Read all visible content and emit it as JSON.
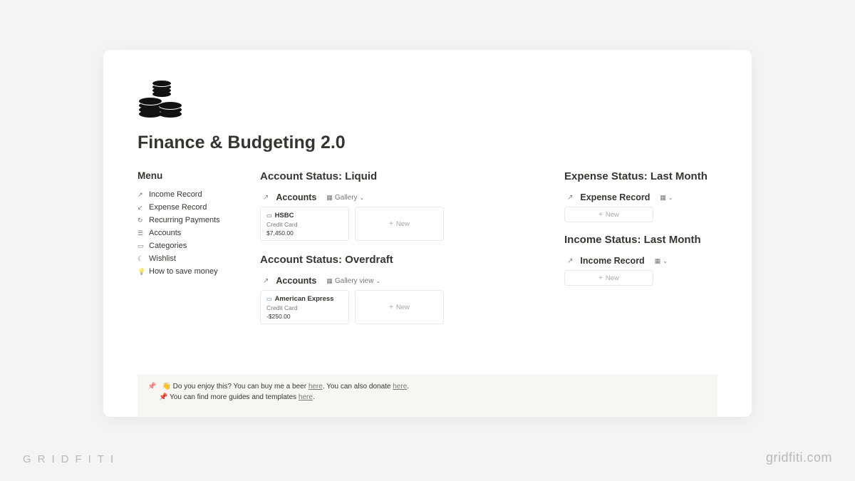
{
  "page": {
    "title": "Finance & Budgeting 2.0"
  },
  "menu": {
    "heading": "Menu",
    "items": [
      {
        "icon": "↗",
        "label": "Income Record"
      },
      {
        "icon": "↙",
        "label": "Expense Record"
      },
      {
        "icon": "↻",
        "label": "Recurring Payments"
      },
      {
        "icon": "☰",
        "label": "Accounts"
      },
      {
        "icon": "▭",
        "label": "Categories"
      },
      {
        "icon": "☾",
        "label": "Wishlist"
      },
      {
        "icon": "💡",
        "label": "How to save money"
      }
    ]
  },
  "liquid": {
    "heading": "Account Status: Liquid",
    "db_title": "Accounts",
    "view_label": "Gallery",
    "card": {
      "icon": "▭",
      "title": "HSBC",
      "tag": "Credit Card",
      "amount": "$7,450.00"
    },
    "new_label": "New"
  },
  "overdraft": {
    "heading": "Account Status: Overdraft",
    "db_title": "Accounts",
    "view_label": "Gallery view",
    "card": {
      "icon": "▭",
      "title": "American Express",
      "tag": "Credit Card",
      "amount": "-$250.00"
    },
    "new_label": "New"
  },
  "expense": {
    "heading": "Expense Status: Last Month",
    "db_title": "Expense Record",
    "new_label": "New"
  },
  "income": {
    "heading": "Income Status: Last Month",
    "db_title": "Income Record",
    "new_label": "New"
  },
  "footer": {
    "line1_pre": "👋 Do you enjoy this? You can buy me a beer ",
    "line1_link1": "here",
    "line1_mid": ". You can also donate ",
    "line1_link2": "here",
    "line1_post": ".",
    "line2_pre": "📌 You can find more guides and templates ",
    "line2_link": "here",
    "line2_post": "."
  },
  "brand": {
    "left": "GRIDFITI",
    "right": "gridfiti.com"
  }
}
